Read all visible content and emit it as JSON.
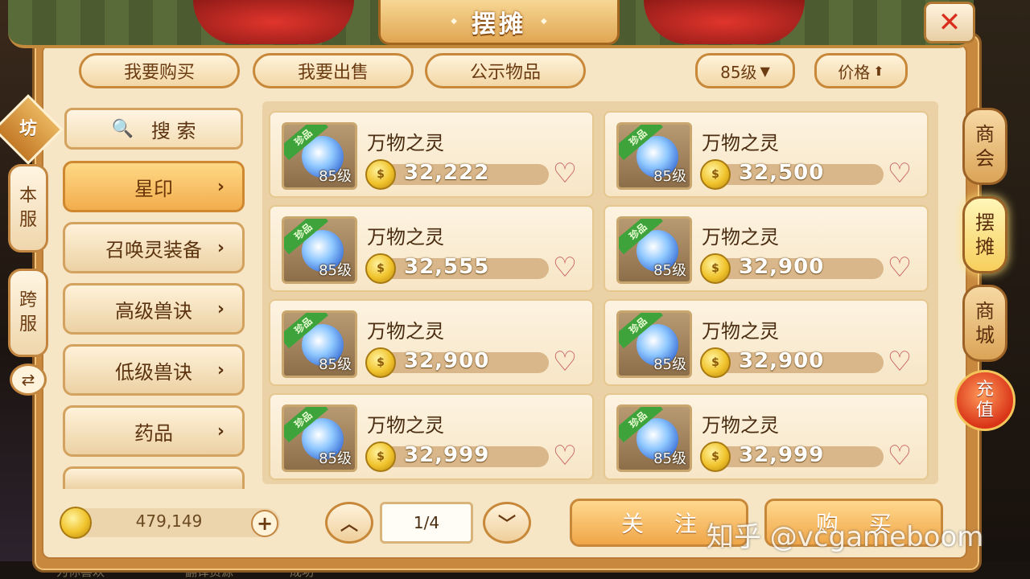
{
  "title": "摆摊",
  "close_symbol": "✕",
  "top_tabs": [
    {
      "label": "我要购买"
    },
    {
      "label": "我要出售"
    },
    {
      "label": "公示物品"
    }
  ],
  "sort": {
    "level": {
      "label": "85级",
      "arrow": "▼"
    },
    "price": {
      "label": "价格",
      "arrow": "⬆"
    }
  },
  "left_side": {
    "badge": "坊",
    "server_tabs": [
      {
        "lines": [
          "本",
          "服"
        ]
      },
      {
        "lines": [
          "跨",
          "服"
        ]
      }
    ],
    "swap_symbol": "⇄"
  },
  "search": {
    "icon": "🔍",
    "label": "搜  索"
  },
  "categories": [
    {
      "label": "星印",
      "active": true
    },
    {
      "label": "召唤灵装备",
      "active": false
    },
    {
      "label": "高级兽诀",
      "active": false
    },
    {
      "label": "低级兽诀",
      "active": false
    },
    {
      "label": "药品",
      "active": false
    }
  ],
  "chevron": "›",
  "items": [
    {
      "name": "万物之灵",
      "price": "32,222",
      "level": "85级",
      "tag": "珍品"
    },
    {
      "name": "万物之灵",
      "price": "32,500",
      "level": "85级",
      "tag": "珍品"
    },
    {
      "name": "万物之灵",
      "price": "32,555",
      "level": "85级",
      "tag": "珍品"
    },
    {
      "name": "万物之灵",
      "price": "32,900",
      "level": "85级",
      "tag": "珍品"
    },
    {
      "name": "万物之灵",
      "price": "32,900",
      "level": "85级",
      "tag": "珍品"
    },
    {
      "name": "万物之灵",
      "price": "32,900",
      "level": "85级",
      "tag": "珍品"
    },
    {
      "name": "万物之灵",
      "price": "32,999",
      "level": "85级",
      "tag": "珍品"
    },
    {
      "name": "万物之灵",
      "price": "32,999",
      "level": "85级",
      "tag": "珍品"
    }
  ],
  "heart_symbol": "♡",
  "wallet": {
    "amount": "479,149",
    "plus": "+"
  },
  "pagination": {
    "prev": "︿",
    "next": "﹀",
    "page": "1/4"
  },
  "actions": {
    "follow": "关注",
    "buy": "购买"
  },
  "watermark": "知乎 @vcgameboom",
  "right_nav": [
    {
      "lines": [
        "商",
        "会"
      ],
      "active": false
    },
    {
      "lines": [
        "摆",
        "摊"
      ],
      "active": true
    },
    {
      "lines": [
        "商",
        "城"
      ],
      "active": false
    }
  ],
  "recharge": {
    "lines": [
      "充",
      "值"
    ]
  },
  "bottom_text": [
    "为你喜欢",
    "翻译资源",
    "成功"
  ],
  "colors": {
    "frame": "#c8893f",
    "panel": "#f6e6c6",
    "active_tab": "#f2ad4d",
    "close_x": "#d92d1d",
    "rare_tag": "#3fa33c"
  }
}
